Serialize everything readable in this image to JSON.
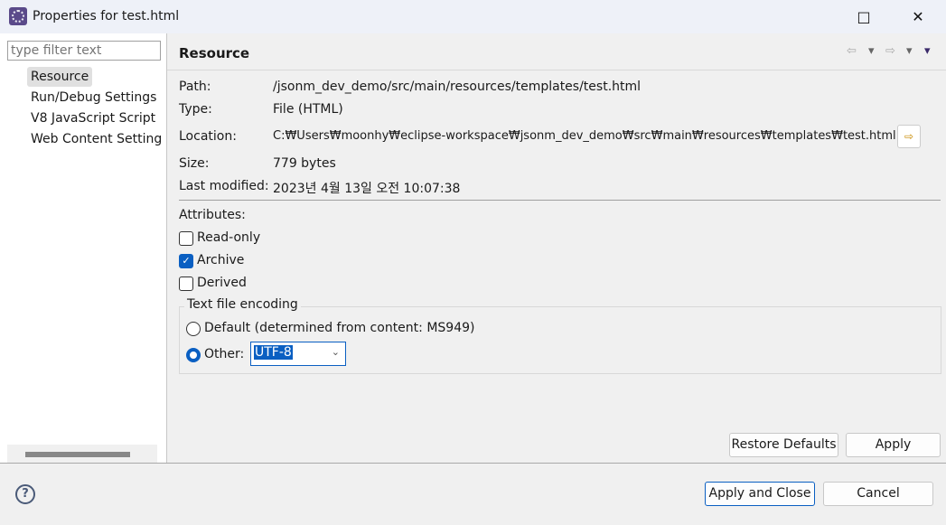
{
  "window": {
    "title": "Properties for test.html",
    "maximize_icon": "□",
    "close_icon": "✕"
  },
  "sidebar": {
    "filter_placeholder": "type filter text",
    "items": [
      {
        "label": "Resource",
        "selected": true
      },
      {
        "label": "Run/Debug Settings"
      },
      {
        "label": "V8 JavaScript Script"
      },
      {
        "label": "Web Content Settings"
      }
    ]
  },
  "page": {
    "title": "Resource",
    "nav": {
      "back": "⇦",
      "back_menu": "▾",
      "forward": "⇨",
      "forward_menu": "▾",
      "view_menu": "▾"
    },
    "fields": [
      {
        "label": "Path:",
        "value": "/jsonm_dev_demo/src/main/resources/templates/test.html"
      },
      {
        "label": "Type:",
        "value": "File  (HTML)"
      },
      {
        "label": "Location:",
        "value": "C:₩Users₩moonhy₩eclipse-workspace₩jsonm_dev_demo₩src₩main₩resources₩templates₩test.html"
      },
      {
        "label": "Size:",
        "value": "779  bytes"
      },
      {
        "label": "Last modified:",
        "value": "2023년 4월 13일 오전 10:07:38"
      }
    ],
    "attributes_label": "Attributes:",
    "attributes": [
      {
        "label": "Read-only",
        "checked": false
      },
      {
        "label": "Archive",
        "checked": true
      },
      {
        "label": "Derived",
        "checked": false
      }
    ],
    "encoding": {
      "group_title": "Text file encoding",
      "default_label": "Default (determined from content: MS949)",
      "other_label": "Other:",
      "selected": "other",
      "value": "UTF-8"
    },
    "restore_defaults": "Restore Defaults",
    "apply": "Apply"
  },
  "footer": {
    "apply_close": "Apply and Close",
    "cancel": "Cancel",
    "help": "?"
  }
}
